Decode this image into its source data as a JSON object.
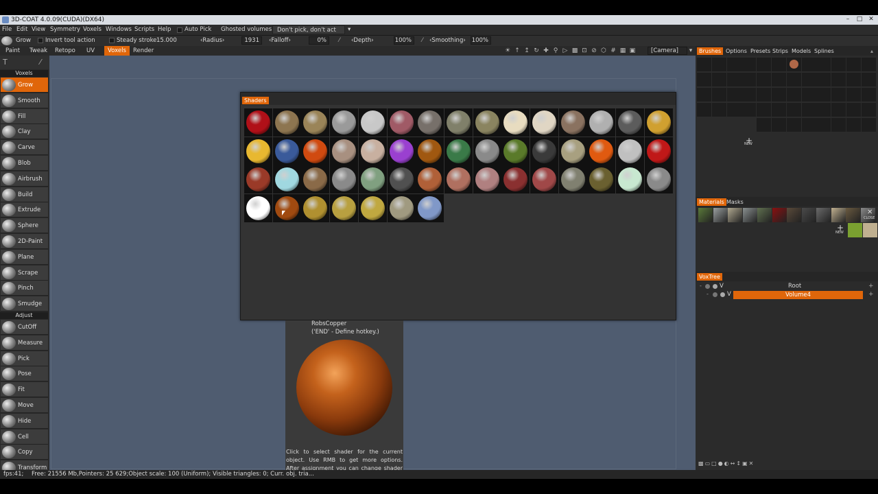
{
  "window": {
    "title": "3D-COAT 4.0.09(CUDA)(DX64)"
  },
  "menu": {
    "items": [
      "File",
      "Edit",
      "View",
      "Symmetry",
      "Voxels",
      "Windows",
      "Scripts",
      "Help"
    ],
    "auto_pick": "Auto Pick",
    "ghosted_label": "Ghosted volumes:",
    "ghosted_value": "Don't pick, don't act"
  },
  "options": {
    "tool_name": "Grow",
    "invert": "Invert tool action",
    "steady": "Steady stroke",
    "steady_value": "15.000",
    "radius_label": "‹Radius›",
    "radius_value": "1931",
    "falloff_label": "‹Falloff›",
    "falloff_value": "0%",
    "depth_label": "‹Depth›",
    "depth_value": "100%",
    "smoothing_label": "‹Smoothing›",
    "smoothing_value": "100%"
  },
  "rooms": {
    "tabs": [
      "Paint",
      "Tweak",
      "Retopo",
      "UV",
      "Voxels",
      "Render"
    ],
    "active": "Voxels",
    "camera": "[Camera]"
  },
  "left": {
    "section_voxels": "Voxels",
    "tools_voxels": [
      "Grow",
      "Smooth",
      "Fill",
      "Clay",
      "Carve",
      "Blob",
      "Airbrush",
      "Build",
      "Extrude",
      "Sphere",
      "2D-Paint",
      "Plane",
      "Scrape",
      "Pinch",
      "Smudge"
    ],
    "section_adjust": "Adjust",
    "tools_adjust": [
      "CutOff",
      "Measure",
      "Pick",
      "Pose",
      "Fit",
      "Move",
      "Hide",
      "Cell",
      "Copy",
      "Transform"
    ]
  },
  "shaders": {
    "title": "Shaders",
    "balls": [
      "#b01018",
      "#8d7550",
      "#9a8458",
      "#9a9a9a",
      "#c8c8c8",
      "#a05a66",
      "#77706a",
      "#80806a",
      "#8a8460",
      "#e8dcc0",
      "#e0d6c4",
      "#8a7260",
      "#b0b0b0",
      "#5c5c5c",
      "#d0a030",
      "#e8b830",
      "#3a5a9a",
      "#d04a10",
      "#a89080",
      "#c8b0a0",
      "#9a40d0",
      "#a05810",
      "#3a7a48",
      "#8a8a8a",
      "#5a7a2a",
      "#3a3a3a",
      "#a8a080",
      "#e05a10",
      "#c0c0c0",
      "#c01818",
      "#9a3a28",
      "#a0d8e0",
      "#8a6a48",
      "#8a8a8a",
      "#80a080",
      "#505050",
      "#b06038",
      "#b07060",
      "#b08080",
      "#8a3030",
      "#a04848",
      "#808070",
      "#6a6030",
      "#c8e8d0",
      "#8a8a8a",
      "#ffffff",
      "#a04a10",
      "#b09030",
      "#b8a040",
      "#c0a840",
      "#a09a80",
      "#8098c8"
    ]
  },
  "preview": {
    "name": "RobsCopper",
    "hotkey": "('END' - Define hotkey.)",
    "description": "Click to select shader for the current object. Use RMB to get more options. After assignment you can change shader properties like color of texture in Voxels"
  },
  "right": {
    "brush_tabs": [
      "Brushes",
      "Options",
      "Presets",
      "Strips",
      "Models",
      "Splines"
    ],
    "brush_tab_active": "Brushes",
    "brush_new": "NEW",
    "material_tabs": [
      "Materials",
      "Masks"
    ],
    "material_new": "NEW",
    "material_close": "CLOSE",
    "voxtree_title": "VoxTree",
    "voxtree": [
      {
        "vis": "V",
        "name": "Root"
      },
      {
        "vis": "V",
        "name": "Volume4"
      }
    ]
  },
  "status": {
    "fps": "fps:41;",
    "info": "Free: 21556 Mb,Pointers: 25 629;Object scale: 100 (Uniform); Visible triangles: 0; Curr. obj. tria..."
  },
  "colors": {
    "accent": "#e0660a",
    "viewport": "#4f5c70",
    "panel": "#2b2b2b"
  }
}
